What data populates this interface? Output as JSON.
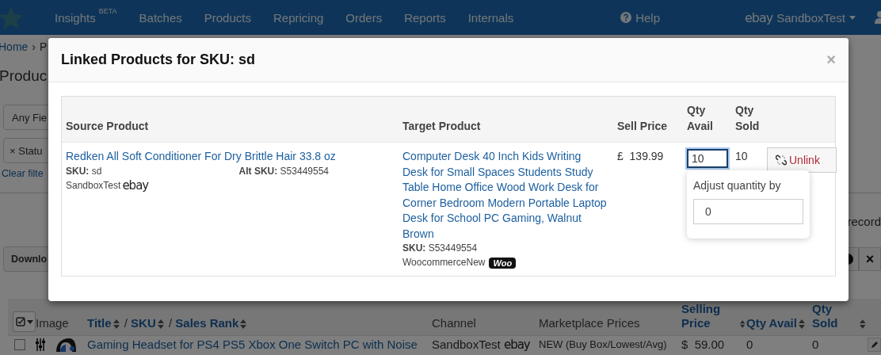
{
  "nav": {
    "items": [
      {
        "label": "Insights",
        "badge": "BETA"
      },
      {
        "label": "Batches"
      },
      {
        "label": "Products"
      },
      {
        "label": "Repricing"
      },
      {
        "label": "Orders"
      },
      {
        "label": "Reports"
      },
      {
        "label": "Internals"
      }
    ],
    "help": "Help",
    "account": {
      "marketplace": {
        "kind": "ebay",
        "label": "ebay"
      },
      "name": "SandboxTest"
    }
  },
  "breadcrumb": {
    "items": [
      "Home",
      "P"
    ],
    "separator": "›"
  },
  "page_title": "Produc",
  "filters": {
    "field": "Any Fie",
    "chip": {
      "remove": "×",
      "label": "Statu"
    },
    "clear_link": "Clear filte"
  },
  "records_text": "record",
  "toolbar": {
    "download": "Downlo",
    "close": "×"
  },
  "products_table": {
    "columns": [
      {
        "parts": [
          "Image"
        ],
        "sortable": false
      },
      {
        "parts": [
          "Title",
          "SKU",
          "Sales Rank"
        ],
        "separator": "/",
        "sortable": true
      },
      {
        "parts": [
          "Channel"
        ],
        "sortable": false
      },
      {
        "parts": [
          "Marketplace Prices"
        ],
        "sortable": false
      },
      {
        "parts": [
          "Selling Price"
        ],
        "sortable": true
      },
      {
        "parts": [
          "Qty Avail"
        ],
        "sortable": true
      },
      {
        "parts": [
          "Qty Sold"
        ],
        "sortable": true
      }
    ],
    "rows": [
      {
        "checked": false,
        "title": "Gaming Headset for PS4 PS5 Xbox One Switch PC with Noise",
        "channel": "SandboxTest",
        "marketplace": {
          "kind": "ebay",
          "label": "ebay"
        },
        "prices": "NEW (Buy Box/Lowest/Avg)",
        "selling_price": "$  59.00",
        "qty_avail": "0",
        "qty_sold": "0"
      }
    ]
  },
  "modal": {
    "title": "Linked Products for SKU: sd",
    "close": "×",
    "columns": [
      "Source Product",
      "Target Product",
      "Sell Price",
      "Qty Avail",
      "Qty Sold"
    ],
    "rows": [
      {
        "source": {
          "title": "Redken All Soft Conditioner For Dry Brittle Hair 33.8 oz",
          "sku": "**SKU:** sd",
          "alt_sku": "**Alt SKU:** S53449554",
          "channel": "SandboxTest",
          "marketplace": {
            "kind": "ebay",
            "label": "ebay"
          }
        },
        "target": {
          "title": "Computer Desk 40 Inch Kids Writing Desk for Small Spaces Students Study Table Home Office Wood Work Desk for Corner Bedroom Modern Portable Laptop Desk for School PC Gaming, Walnut Brown",
          "sku": "**SKU:** S53449554",
          "channel": "WoocommerceNew",
          "marketplace": {
            "kind": "woo",
            "label": "Woo"
          }
        },
        "sell_price": "£  139.99",
        "qty_avail": {
          "value": "10",
          "focused": true
        },
        "qty_sold": "10",
        "unlink": "Unlink",
        "adjust": {
          "label": "Adjust quantity by",
          "value": "0"
        }
      }
    ]
  }
}
